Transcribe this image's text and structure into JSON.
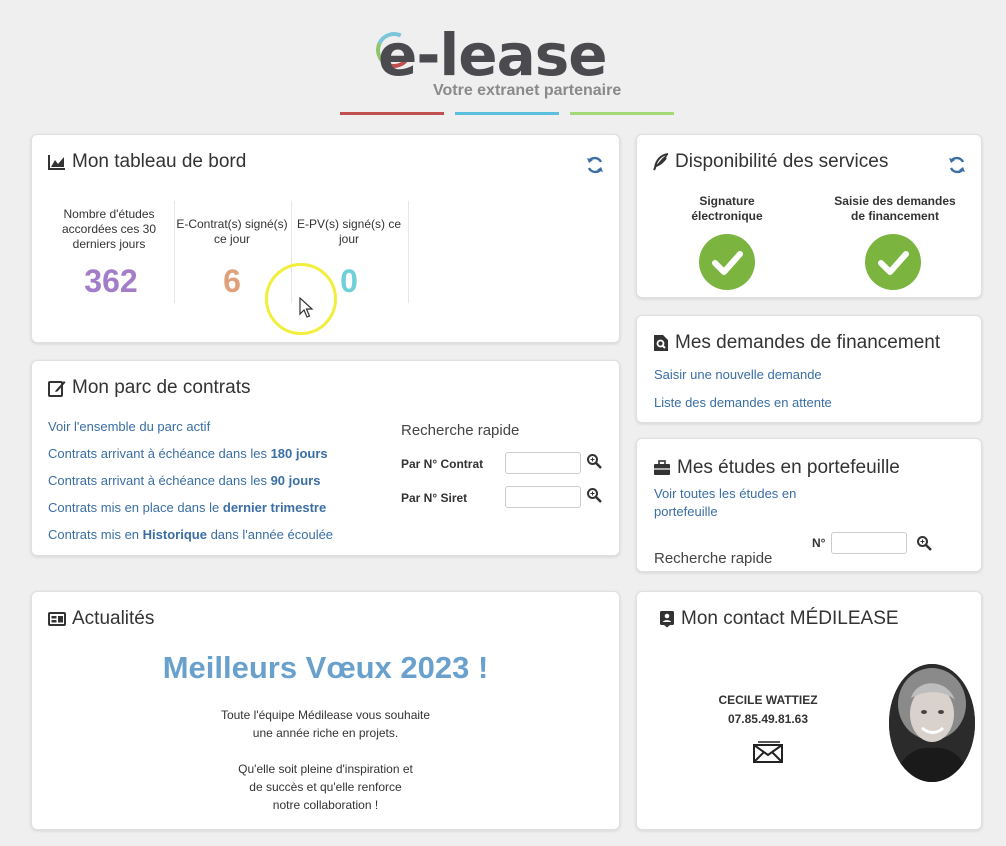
{
  "header": {
    "logo": "e-lease",
    "tagline": "Votre extranet partenaire"
  },
  "dashboard": {
    "title": "Mon tableau de bord",
    "stats": [
      {
        "label": "Nombre d'études accordées ces 30 derniers jours",
        "value": "362",
        "color": "#a47dc8"
      },
      {
        "label": "E-Contrat(s) signé(s) ce jour",
        "value": "6",
        "color": "#e0a17a"
      },
      {
        "label": "E-PV(s) signé(s) ce jour",
        "value": "0",
        "color": "#6fd0d8"
      }
    ]
  },
  "services": {
    "title": "Disponibilité des services",
    "items": [
      {
        "label": "Signature électronique",
        "status": "ok"
      },
      {
        "label": "Saisie des demandes de financement",
        "status": "ok"
      }
    ]
  },
  "parc": {
    "title": "Mon parc de contrats",
    "links": [
      {
        "pre": "Voir l'ensemble du parc actif",
        "bold": "",
        "post": ""
      },
      {
        "pre": "Contrats arrivant à échéance dans les ",
        "bold": "180 jours",
        "post": ""
      },
      {
        "pre": "Contrats arrivant à échéance dans les ",
        "bold": "90 jours",
        "post": ""
      },
      {
        "pre": "Contrats mis en place dans le ",
        "bold": "dernier trimestre",
        "post": ""
      },
      {
        "pre": "Contrats mis en ",
        "bold": "Historique",
        "post": " dans l'année écoulée"
      }
    ],
    "search_title": "Recherche rapide",
    "search_contrat_label": "Par N° Contrat",
    "search_siret_label": "Par N° Siret",
    "search_contrat_value": "",
    "search_siret_value": ""
  },
  "demandes": {
    "title": "Mes demandes de financement",
    "links": [
      "Saisir une nouvelle demande",
      "Liste des demandes en attente"
    ]
  },
  "etudes": {
    "title": "Mes études en portefeuille",
    "link": "Voir toutes les études en portefeuille",
    "search_title": "Recherche rapide",
    "search_label": "N°",
    "search_value": ""
  },
  "news": {
    "title": "Actualités",
    "headline": "Meilleurs Vœux 2023 !",
    "lines1": [
      "Toute l'équipe Médilease vous souhaite",
      "une année riche en projets."
    ],
    "lines2": [
      "Qu'elle soit pleine d'inspiration et",
      "de succès et qu'elle renforce",
      "notre collaboration !"
    ]
  },
  "contact": {
    "title": "Mon contact MÉDILEASE",
    "name": "CECILE WATTIEZ",
    "phone": "07.85.49.81.63"
  },
  "colors": {
    "link": "#3a6ea5",
    "ok": "#7cb440",
    "headline": "#6aa1cc"
  }
}
